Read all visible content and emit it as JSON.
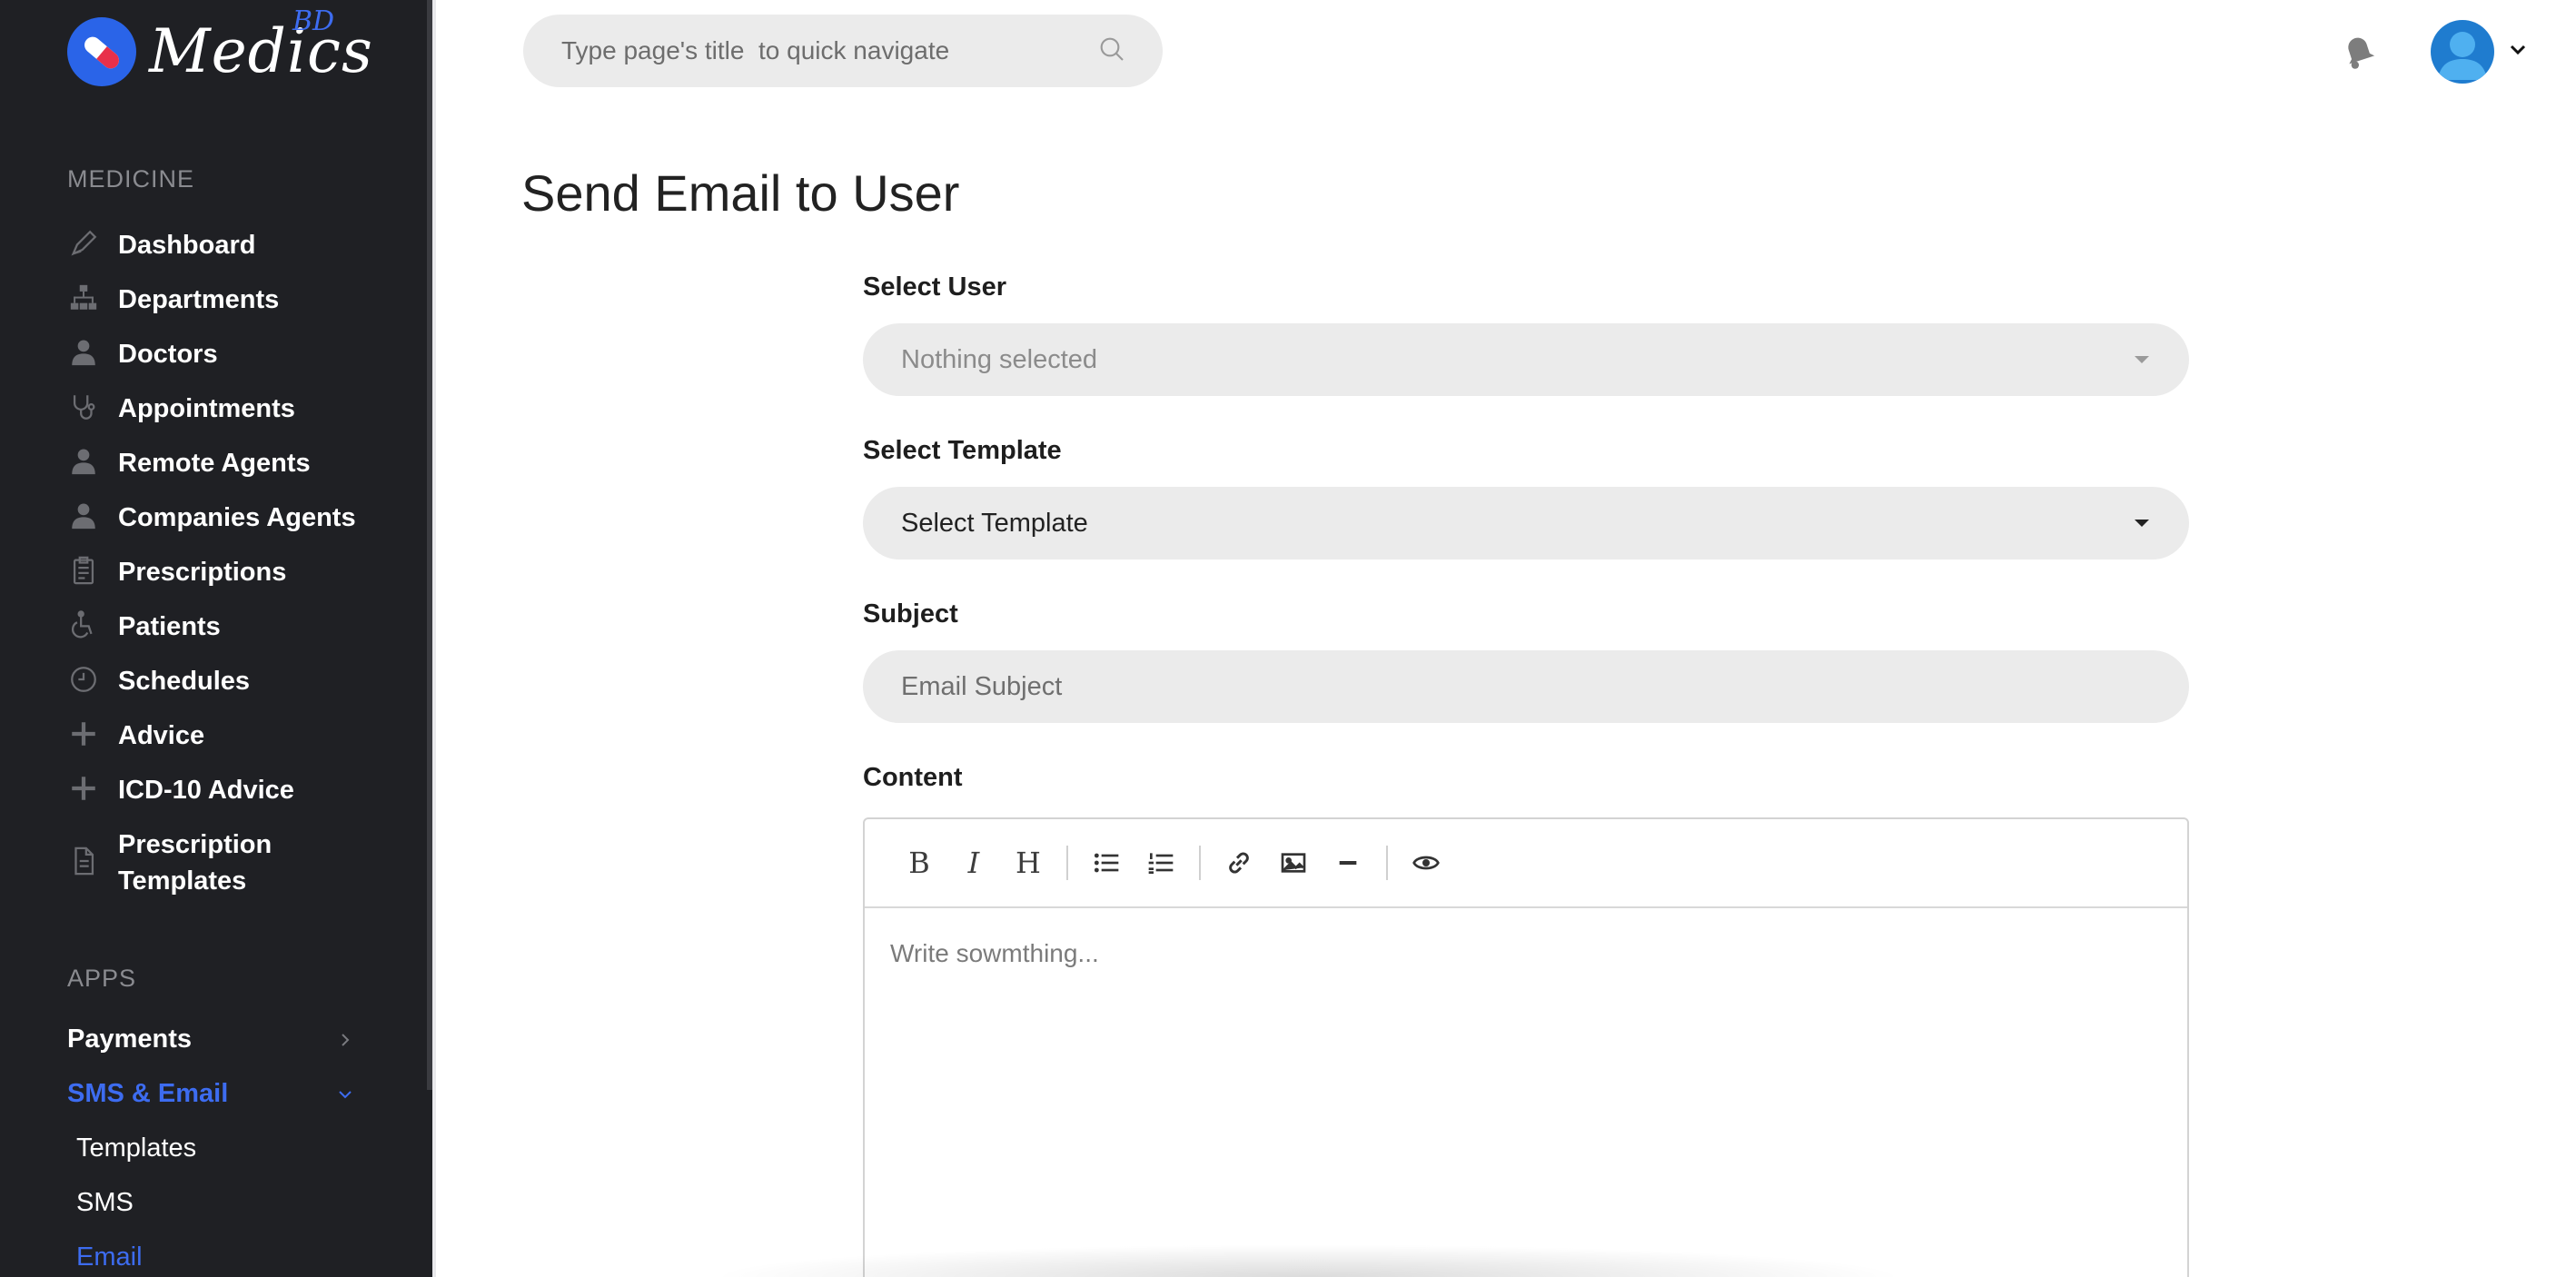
{
  "brand": {
    "name": "Medics",
    "sup": "BD"
  },
  "sidebar": {
    "section_medicine": "MEDICINE",
    "items": [
      {
        "label": "Dashboard",
        "icon": "pen-icon"
      },
      {
        "label": "Departments",
        "icon": "hierarchy-icon"
      },
      {
        "label": "Doctors",
        "icon": "doctor-icon"
      },
      {
        "label": "Appointments",
        "icon": "stethoscope-icon"
      },
      {
        "label": "Remote Agents",
        "icon": "agent-icon"
      },
      {
        "label": "Companies Agents",
        "icon": "agent-icon"
      },
      {
        "label": "Prescriptions",
        "icon": "clipboard-icon"
      },
      {
        "label": "Patients",
        "icon": "wheelchair-icon"
      },
      {
        "label": "Schedules",
        "icon": "clock-icon"
      },
      {
        "label": "Advice",
        "icon": "plus-icon"
      },
      {
        "label": "ICD-10 Advice",
        "icon": "plus-icon"
      },
      {
        "label_line1": "Prescription",
        "label_line2": "Templates",
        "icon": "document-icon"
      }
    ],
    "section_apps": "APPS",
    "apps": [
      {
        "label": "Payments",
        "state": "collapsed"
      },
      {
        "label": "SMS & Email",
        "state": "expanded"
      }
    ],
    "sub_items": [
      {
        "label": "Templates"
      },
      {
        "label": "SMS"
      },
      {
        "label": "Email"
      }
    ]
  },
  "topbar": {
    "search_placeholder": "Type page's title  to quick navigate"
  },
  "page": {
    "title": "Send Email to User"
  },
  "form": {
    "select_user_label": "Select User",
    "select_user_value": "Nothing selected",
    "select_template_label": "Select Template",
    "select_template_value": "Select Template",
    "subject_label": "Subject",
    "subject_placeholder": "Email Subject",
    "content_label": "Content",
    "content_placeholder": "Write sowmthing..."
  },
  "toolbar": {
    "bold": "B",
    "italic": "I",
    "heading": "H"
  },
  "colors": {
    "sidebar_bg": "#1f2024",
    "accent": "#3d6cf0",
    "field_bg": "#ebebeb"
  }
}
